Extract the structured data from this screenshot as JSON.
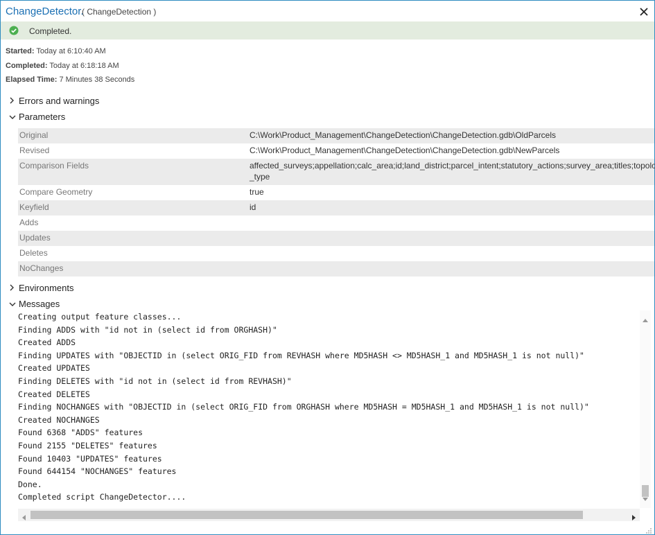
{
  "window": {
    "title": "ChangeDetector.",
    "subtitle": "( ChangeDetection )"
  },
  "status": {
    "text": "Completed.",
    "color": "#4caf50"
  },
  "meta": {
    "started_label": "Started:",
    "started_value": "Today at 6:10:40 AM",
    "completed_label": "Completed:",
    "completed_value": "Today at 6:18:18 AM",
    "elapsed_label": "Elapsed Time:",
    "elapsed_value": "7 Minutes 38 Seconds"
  },
  "sections": {
    "errors": "Errors and warnings",
    "parameters": "Parameters",
    "environments": "Environments",
    "messages": "Messages"
  },
  "parameters": [
    {
      "name": "Original",
      "value": "C:\\Work\\Product_Management\\ChangeDetection\\ChangeDetection.gdb\\OldParcels"
    },
    {
      "name": "Revised",
      "value": "C:\\Work\\Product_Management\\ChangeDetection\\ChangeDetection.gdb\\NewParcels"
    },
    {
      "name": "Comparison Fields",
      "value": "affected_surveys;appellation;calc_area;id;land_district;parcel_intent;statutory_actions;survey_area;titles;topology",
      "value2": "_type"
    },
    {
      "name": "Compare Geometry",
      "value": "true"
    },
    {
      "name": "Keyfield",
      "value": "id"
    },
    {
      "name": "Adds",
      "value": ""
    },
    {
      "name": "Updates",
      "value": ""
    },
    {
      "name": "Deletes",
      "value": ""
    },
    {
      "name": "NoChanges",
      "value": ""
    }
  ],
  "messages": [
    "Creating output feature classes...",
    "Finding ADDS with \"id not in (select id from ORGHASH)\"",
    "Created ADDS",
    "Finding UPDATES with \"OBJECTID in (select ORIG_FID from REVHASH where MD5HASH <> MD5HASH_1 and MD5HASH_1 is not null)\"",
    "Created UPDATES",
    "Finding DELETES with \"id not in (select id from REVHASH)\"",
    "Created DELETES",
    "Finding NOCHANGES with \"OBJECTID in (select ORIG_FID from ORGHASH where MD5HASH = MD5HASH_1 and MD5HASH_1 is not null)\"",
    "Created NOCHANGES",
    "Found 6368 \"ADDS\" features",
    "Found 2155 \"DELETES\" features",
    "Found 10403 \"UPDATES\" features",
    "Found 644154 \"NOCHANGES\" features",
    "Done.",
    "Completed script ChangeDetector...."
  ],
  "icons": {
    "close": "close-icon",
    "status": "check-circle-icon",
    "collapsed": "chevron-right-icon",
    "expanded": "chevron-down-icon"
  }
}
